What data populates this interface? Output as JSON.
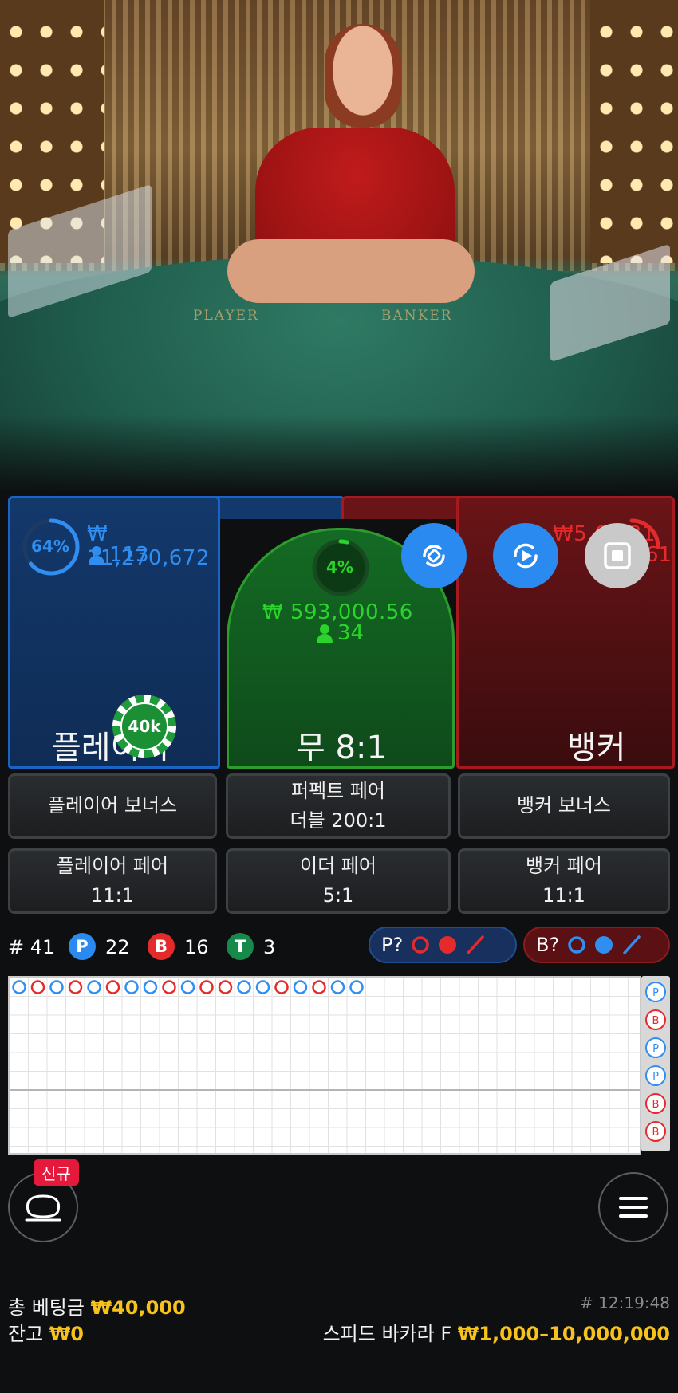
{
  "table_labels": {
    "player": "PLAYER",
    "banker": "BANKER"
  },
  "player": {
    "percent": "64%",
    "percent_value": 0.64,
    "amount": "₩ 11,270,672",
    "bettors": "113",
    "label": "플레이어",
    "color": "#2f8ef0"
  },
  "tie": {
    "percent": "4%",
    "percent_value": 0.04,
    "amount": "₩ 593,000.56",
    "bettors": "34",
    "label": "무 8:1",
    "color": "#2bd42b"
  },
  "banker": {
    "amount_partial": "₩5,6 431",
    "bettors_partial": "61",
    "label": "뱅커",
    "color": "#e42a2a"
  },
  "chip": {
    "label": "40k"
  },
  "controls": {
    "rotate_icon": "rotate-icon",
    "autoplay_icon": "autoplay-icon",
    "stop_icon": "stop-icon"
  },
  "side_bets": [
    {
      "line1": "플레이어 보너스",
      "line2": ""
    },
    {
      "line1": "퍼펙트 페어",
      "line2": "더블 200:1"
    },
    {
      "line1": "뱅커 보너스",
      "line2": ""
    },
    {
      "line1": "플레이어 페어",
      "line2": "11:1"
    },
    {
      "line1": "이더 페어",
      "line2": "5:1"
    },
    {
      "line1": "뱅커 페어",
      "line2": "11:1"
    }
  ],
  "stats": {
    "round": "# 41",
    "player_letter": "P",
    "player_count": "22",
    "banker_letter": "B",
    "banker_count": "16",
    "tie_letter": "T",
    "tie_count": "3",
    "player_predict": "P?",
    "banker_predict": "B?"
  },
  "roadmap": {
    "big_road": [
      [
        "P",
        "B",
        "P",
        "B",
        "P",
        "B",
        "P",
        "P",
        "B",
        "P",
        "B",
        "B",
        "P",
        "P",
        "B",
        "P",
        "B",
        "P",
        "P"
      ],
      [],
      [],
      []
    ],
    "side_column": [
      "P",
      "B",
      "P",
      "P",
      "B",
      "B"
    ]
  },
  "new_tag": "신규",
  "footer": {
    "total_bet_label": "총 베팅금",
    "total_bet_value": "₩40,000",
    "balance_label": "잔고",
    "balance_value": "₩0",
    "time": "# 12:19:48",
    "game_name": "스피드 바카라 F",
    "limits": "₩1,000–10,000,000"
  },
  "colors": {
    "player_blue": "#2f8ef0",
    "banker_red": "#e42a2a",
    "tie_green": "#27ae3b",
    "gold": "#f7c21b"
  }
}
